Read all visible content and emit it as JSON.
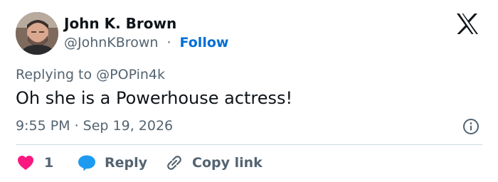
{
  "author": {
    "name": "John K. Brown",
    "handle": "@JohnKBrown",
    "separator": "·",
    "follow_label": "Follow",
    "avatar": "profile-photo"
  },
  "brand": {
    "icon": "x-logo-icon"
  },
  "tweet": {
    "replying_to": "Replying to @POPin4k",
    "text": "Oh she is a Powerhouse actress!",
    "timestamp": "9:55 PM · Sep 19, 2026"
  },
  "actions": {
    "like_count": "1",
    "reply_label": "Reply",
    "copy_link_label": "Copy link"
  },
  "colors": {
    "heart": "#f91880",
    "reply_bubble": "#1d9bf0",
    "follow": "#006fd6",
    "secondary_text": "#536471",
    "primary_text": "#0f1419",
    "divider": "#cfd9de"
  },
  "icons": [
    "heart-icon",
    "reply-bubble-icon",
    "link-icon",
    "info-icon"
  ]
}
